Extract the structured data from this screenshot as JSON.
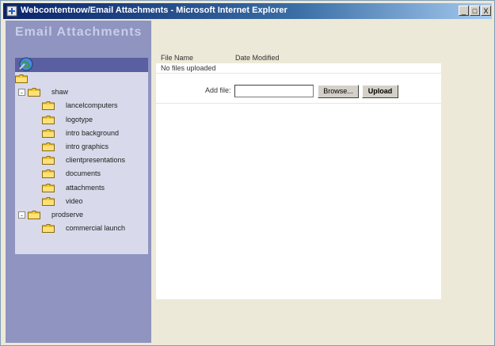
{
  "window": {
    "title": "Webcontentnow/Email Attachments - Microsoft Internet Explorer",
    "controls": {
      "minimize": "_",
      "maximize": "□",
      "close": "X"
    }
  },
  "app": {
    "title": "Email Attachments"
  },
  "tree": {
    "items": [
      {
        "label": "",
        "level": 0,
        "expander": ""
      },
      {
        "label": "shaw",
        "level": 1,
        "expander": "-"
      },
      {
        "label": "lancelcomputers",
        "level": 2,
        "expander": ""
      },
      {
        "label": "logotype",
        "level": 2,
        "expander": ""
      },
      {
        "label": "intro background",
        "level": 2,
        "expander": ""
      },
      {
        "label": "intro graphics",
        "level": 2,
        "expander": ""
      },
      {
        "label": "clientpresentations",
        "level": 2,
        "expander": ""
      },
      {
        "label": "documents",
        "level": 2,
        "expander": ""
      },
      {
        "label": "attachments",
        "level": 2,
        "expander": ""
      },
      {
        "label": "video",
        "level": 2,
        "expander": ""
      },
      {
        "label": "prodserve",
        "level": 1,
        "expander": "-"
      },
      {
        "label": "commercial launch",
        "level": 2,
        "expander": ""
      }
    ]
  },
  "files": {
    "headers": {
      "name": "File Name",
      "date": "Date Modified"
    },
    "empty_message": "No files uploaded",
    "add_label": "Add file:",
    "input_value": "",
    "browse_label": "Browse...",
    "upload_label": "Upload"
  },
  "colors": {
    "sidebar": "#8f94c0",
    "titlebar": "#0a246a",
    "folder": "#f4c830"
  }
}
